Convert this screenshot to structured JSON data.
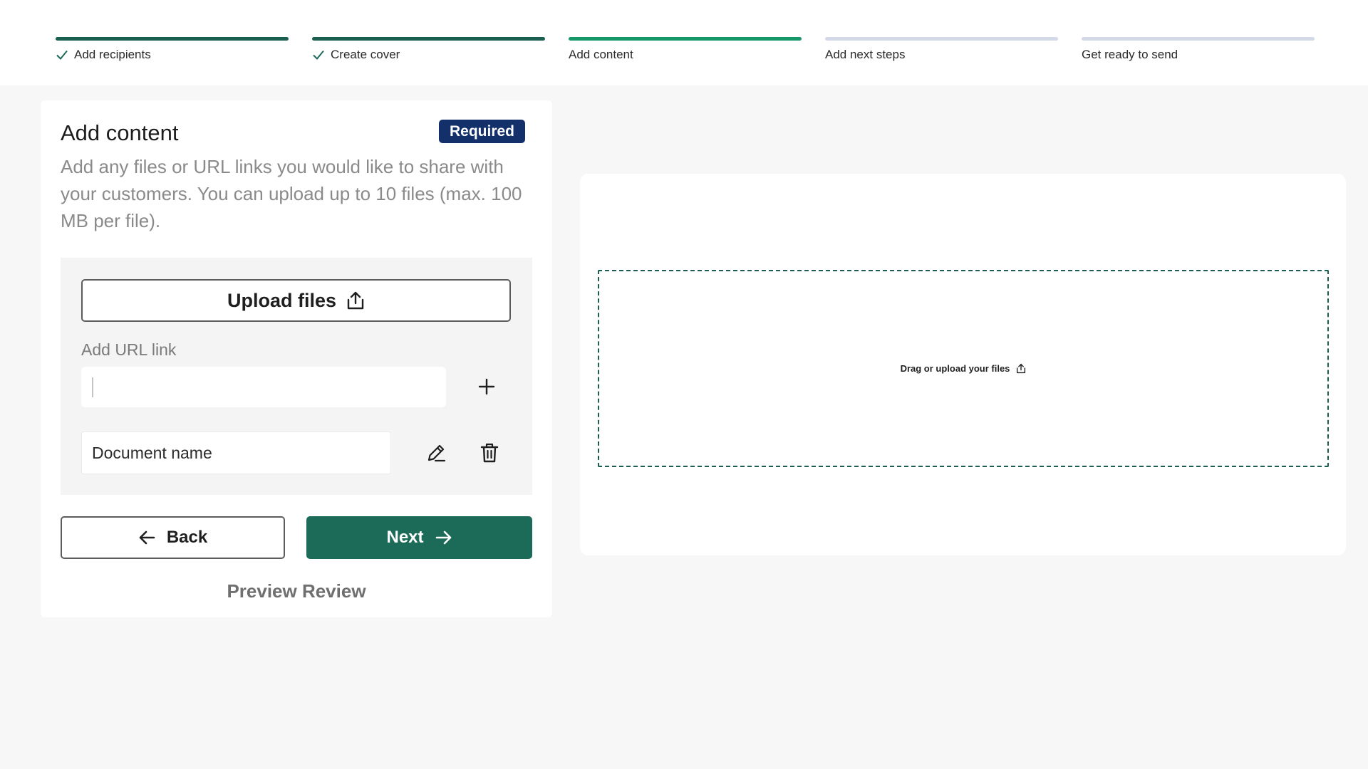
{
  "stepper": {
    "steps": [
      {
        "label": "Add recipients",
        "state": "done"
      },
      {
        "label": "Create cover",
        "state": "done"
      },
      {
        "label": "Add content",
        "state": "active"
      },
      {
        "label": "Add next steps",
        "state": "pending"
      },
      {
        "label": "Get ready to send",
        "state": "pending"
      }
    ]
  },
  "panel": {
    "title": "Add content",
    "badge": "Required",
    "description": "Add any files or URL links you would like to share with your customers. You can upload up to 10 files (max. 100 MB per file).",
    "upload_label": "Upload files",
    "url_label": "Add URL link",
    "url_value": "",
    "document_name": "Document name",
    "back_label": "Back",
    "next_label": "Next",
    "preview_label": "Preview Review"
  },
  "preview": {
    "dropzone_label": "Drag or upload your files"
  },
  "colors": {
    "primary": "#1b6b58",
    "step_done": "#1b5f50",
    "step_active": "#169868",
    "step_pending": "#d4d9e8",
    "badge": "#14306b"
  }
}
